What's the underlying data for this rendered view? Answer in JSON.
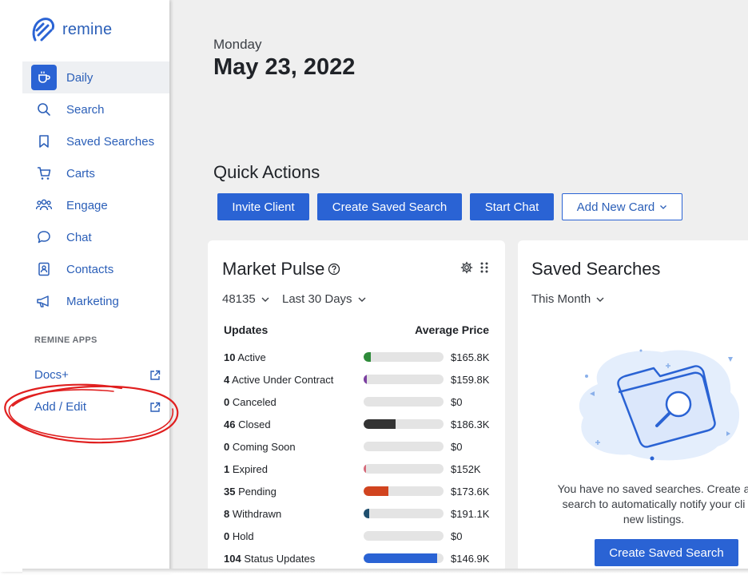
{
  "brand": {
    "name": "remine",
    "color": "#2a63d4"
  },
  "sidebar": {
    "items": [
      {
        "label": "Daily",
        "icon": "coffee-cup-icon",
        "active": true
      },
      {
        "label": "Search",
        "icon": "search-icon"
      },
      {
        "label": "Saved Searches",
        "icon": "bookmark-icon"
      },
      {
        "label": "Carts",
        "icon": "cart-icon"
      },
      {
        "label": "Engage",
        "icon": "people-icon"
      },
      {
        "label": "Chat",
        "icon": "chat-bubble-icon"
      },
      {
        "label": "Contacts",
        "icon": "contact-book-icon"
      },
      {
        "label": "Marketing",
        "icon": "megaphone-icon"
      }
    ],
    "apps_heading": "REMINE APPS",
    "apps": [
      {
        "label": "Docs+",
        "icon": "external-link-icon"
      },
      {
        "label": "Add / Edit",
        "icon": "external-link-icon"
      }
    ]
  },
  "header": {
    "day": "Monday",
    "date": "May 23, 2022"
  },
  "quick_actions": {
    "title": "Quick Actions",
    "buttons": [
      "Invite Client",
      "Create Saved Search",
      "Start Chat"
    ],
    "add_card": "Add New Card"
  },
  "market_pulse": {
    "title": "Market Pulse",
    "zip": "48135",
    "period": "Last 30 Days",
    "col_updates": "Updates",
    "col_price": "Average Price",
    "rows": [
      {
        "count": "10",
        "status": "Active",
        "price": "$165.8K",
        "fill": 0.09,
        "color": "#2e8b3a"
      },
      {
        "count": "4",
        "status": "Active Under Contract",
        "price": "$159.8K",
        "fill": 0.04,
        "color": "#7b3fa0"
      },
      {
        "count": "0",
        "status": "Canceled",
        "price": "$0",
        "fill": 0,
        "color": "#999999"
      },
      {
        "count": "46",
        "status": "Closed",
        "price": "$186.3K",
        "fill": 0.4,
        "color": "#333333"
      },
      {
        "count": "0",
        "status": "Coming Soon",
        "price": "$0",
        "fill": 0,
        "color": "#999999"
      },
      {
        "count": "1",
        "status": "Expired",
        "price": "$152K",
        "fill": 0.01,
        "color": "#d66a7a"
      },
      {
        "count": "35",
        "status": "Pending",
        "price": "$173.6K",
        "fill": 0.31,
        "color": "#d1441f"
      },
      {
        "count": "8",
        "status": "Withdrawn",
        "price": "$191.1K",
        "fill": 0.07,
        "color": "#1f4f6e"
      },
      {
        "count": "0",
        "status": "Hold",
        "price": "$0",
        "fill": 0,
        "color": "#999999"
      },
      {
        "count": "104",
        "status": "Status Updates",
        "price": "$146.9K",
        "fill": 0.92,
        "color": "#2a63d4"
      }
    ]
  },
  "saved_searches": {
    "title": "Saved Searches",
    "period": "This Month",
    "message_line1": "You have no saved searches. Create a",
    "message_line2": "search to automatically notify your cli",
    "message_line3": "new listings.",
    "button": "Create Saved Search"
  }
}
